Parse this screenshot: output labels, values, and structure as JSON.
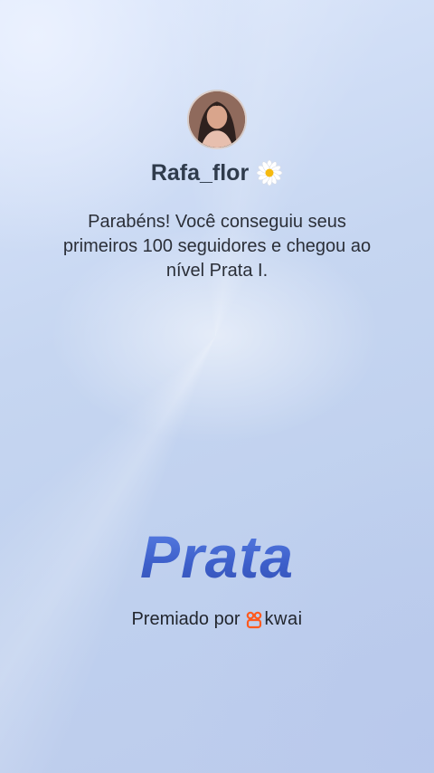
{
  "profile": {
    "username": "Rafa_flor",
    "badge_icon": "daisy-flower-icon",
    "avatar_icon": "profile-avatar"
  },
  "message": "Parabéns! Você conseguiu seus primeiros 100 seguidores e chegou ao nível Prata I.",
  "tier": {
    "name": "Prata",
    "color": "#4468cf"
  },
  "award": {
    "prefix": "Premiado por",
    "brand": "kwai",
    "brand_icon": "kwai-logo-icon",
    "brand_color": "#ff5a1f"
  }
}
